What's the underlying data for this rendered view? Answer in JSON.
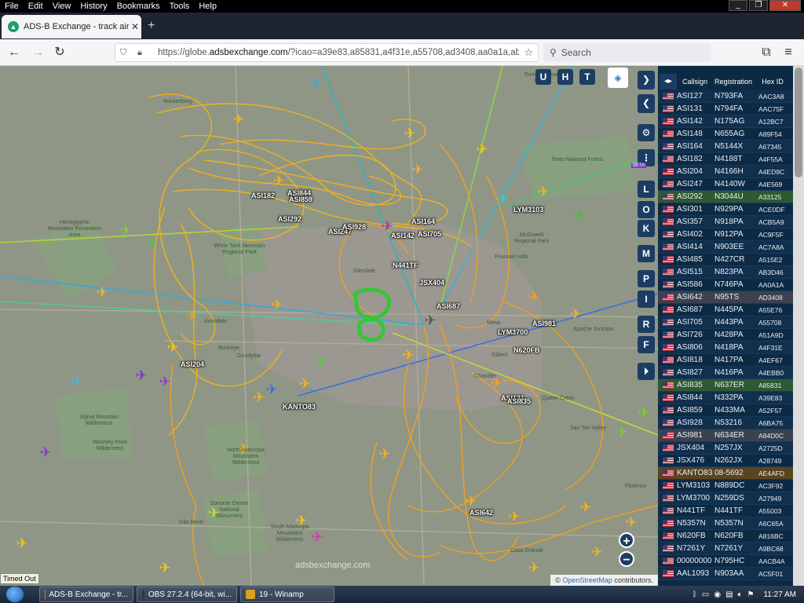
{
  "menu": {
    "items": [
      "File",
      "Edit",
      "View",
      "History",
      "Bookmarks",
      "Tools",
      "Help"
    ]
  },
  "window_controls": {
    "minimize": "_",
    "restore": "❐",
    "close": "✕"
  },
  "tab": {
    "title": "ADS-B Exchange - track aircraft",
    "close": "✕",
    "new_tab": "+"
  },
  "nav": {
    "url_prefix": "https://globe.",
    "url_domain": "adsbexchange.com",
    "url_rest": "/?icao=a39e83,a85831,a4f31e,a55708,ad3408,aa0a1a,ab3d4",
    "search_placeholder": "Search"
  },
  "map": {
    "layer_buttons": [
      "U",
      "H",
      "T"
    ],
    "side_buttons": [
      "L",
      "O",
      "K",
      "M",
      "P",
      "I",
      "R",
      "F"
    ],
    "beta_badge": "BETA",
    "zoom_in": "+",
    "zoom_out": "−",
    "watermark": "adsbexchange.com",
    "attribution_prefix": "©",
    "attribution_link": "OpenStreetMap",
    "attribution_suffix": "contributors.",
    "timed_out": "Timed Out",
    "place_labels": [
      "Wickenburg",
      "Tonto National Forest",
      "Hieroglyphic Mountains Recreation Area",
      "White Tank Mountain Regional Park",
      "Glendale",
      "Avondale",
      "Buckeye",
      "Goodyear",
      "Mesa",
      "Gilbert",
      "Chandler",
      "Queen Creek",
      "San Tan Valley",
      "Apache Junction",
      "Fountain Hills",
      "Signal Mountain Wilderness",
      "Woolsey Peak Wilderness",
      "North Maricopa Mountains Wilderness",
      "South Maricopa Mountains Wilderness",
      "Sonoran Desert National Monument",
      "Gila Bend",
      "Casa Grande",
      "Florence",
      "McDowell Regional Park",
      "Tonto National Forest"
    ],
    "aircraft_labels": [
      "ASI182",
      "ASI844",
      "ASI859",
      "ASI292",
      "ASI247",
      "ASI928",
      "ASI142",
      "ASI705",
      "ASI164",
      "LYM3103",
      "N441TF",
      "JSX404",
      "ASI687",
      "LYM3700",
      "ASI981",
      "N620FB",
      "ASI204",
      "KANTO83",
      "ASI131",
      "ASI835",
      "ASI642"
    ]
  },
  "table": {
    "headers": {
      "callsign": "Callsign",
      "registration": "Registration",
      "hexid": "Hex ID"
    },
    "toggle": "◂▸",
    "rows": [
      {
        "callsign": "ASI127",
        "registration": "N793FA",
        "hex": "AAC3A8"
      },
      {
        "callsign": "ASI131",
        "registration": "N794FA",
        "hex": "AAC75F"
      },
      {
        "callsign": "ASI142",
        "registration": "N175AG",
        "hex": "A12BC7"
      },
      {
        "callsign": "ASI148",
        "registration": "N655AG",
        "hex": "A89F54"
      },
      {
        "callsign": "ASI164",
        "registration": "N5144X",
        "hex": "A67345"
      },
      {
        "callsign": "ASI182",
        "registration": "N4188T",
        "hex": "A4F55A"
      },
      {
        "callsign": "ASI204",
        "registration": "N4166H",
        "hex": "A4ED9C"
      },
      {
        "callsign": "ASI247",
        "registration": "N4140W",
        "hex": "A4E569"
      },
      {
        "callsign": "ASI292",
        "registration": "N3044U",
        "hex": "A33125"
      },
      {
        "callsign": "ASI301",
        "registration": "N929PA",
        "hex": "ACE0DF"
      },
      {
        "callsign": "ASI357",
        "registration": "N918PA",
        "hex": "ACB5A9"
      },
      {
        "callsign": "ASI402",
        "registration": "N912PA",
        "hex": "AC9F5F"
      },
      {
        "callsign": "ASI414",
        "registration": "N903EE",
        "hex": "AC7A8A"
      },
      {
        "callsign": "ASI485",
        "registration": "N427CR",
        "hex": "A515E2"
      },
      {
        "callsign": "ASI515",
        "registration": "N823PA",
        "hex": "AB3D46"
      },
      {
        "callsign": "ASI586",
        "registration": "N746PA",
        "hex": "AA0A1A"
      },
      {
        "callsign": "ASI642",
        "registration": "N95TS",
        "hex": "AD3408"
      },
      {
        "callsign": "ASI687",
        "registration": "N445PA",
        "hex": "A55E76"
      },
      {
        "callsign": "ASI705",
        "registration": "N443PA",
        "hex": "A55708"
      },
      {
        "callsign": "ASI726",
        "registration": "N428PA",
        "hex": "A51A9D"
      },
      {
        "callsign": "ASI806",
        "registration": "N418PA",
        "hex": "A4F31E"
      },
      {
        "callsign": "ASI818",
        "registration": "N417PA",
        "hex": "A4EF67"
      },
      {
        "callsign": "ASI827",
        "registration": "N416PA",
        "hex": "A4EBB0"
      },
      {
        "callsign": "ASI835",
        "registration": "N637ER",
        "hex": "A85831"
      },
      {
        "callsign": "ASI844",
        "registration": "N332PA",
        "hex": "A39E83"
      },
      {
        "callsign": "ASI859",
        "registration": "N433MA",
        "hex": "A52F57"
      },
      {
        "callsign": "ASI928",
        "registration": "N53216",
        "hex": "A6BA75"
      },
      {
        "callsign": "ASI981",
        "registration": "N634ER",
        "hex": "A84D0C"
      },
      {
        "callsign": "JSX404",
        "registration": "N257JX",
        "hex": "A2725D"
      },
      {
        "callsign": "JSX476",
        "registration": "N262JX",
        "hex": "A28749"
      },
      {
        "callsign": "KANTO83",
        "registration": "08-5692",
        "hex": "AE4AFD"
      },
      {
        "callsign": "LYM3103",
        "registration": "N889DC",
        "hex": "AC3F92"
      },
      {
        "callsign": "LYM3700",
        "registration": "N259DS",
        "hex": "A27949"
      },
      {
        "callsign": "N441TF",
        "registration": "N441TF",
        "hex": "A55003"
      },
      {
        "callsign": "N5357N",
        "registration": "N5357N",
        "hex": "A6C65A"
      },
      {
        "callsign": "N620FB",
        "registration": "N620FB",
        "hex": "A816BC"
      },
      {
        "callsign": "N7261Y",
        "registration": "N7261Y",
        "hex": "A9BC68"
      },
      {
        "callsign": "00000000",
        "registration": "N795HC",
        "hex": "AACB4A"
      },
      {
        "callsign": "AAL1093",
        "registration": "N903AA",
        "hex": "AC5F01"
      }
    ]
  },
  "taskbar": {
    "tasks": [
      "ADS-B Exchange - tr...",
      "OBS 27.2.4 (64-bit, wi...",
      "19 - Winamp"
    ],
    "clock": "11:27 AM"
  }
}
